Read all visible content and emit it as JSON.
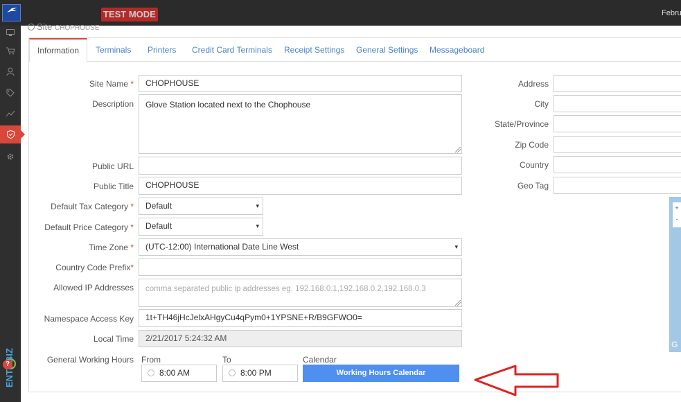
{
  "topbar": {
    "test_mode": "TEST MODE",
    "date": "Februa",
    "logo_text": "Mizuno"
  },
  "sidebar": {
    "brand": "ENTOBIZ",
    "help": "?",
    "icons": [
      "monitor-icon",
      "cart-icon",
      "users-icon",
      "tag-icon",
      "chart-icon",
      "shield-icon",
      "gear-icon"
    ]
  },
  "page": {
    "title": "Site",
    "subtitle": "CHOPHOUSE"
  },
  "tabs": [
    "Information",
    "Terminals",
    "Printers",
    "Credit Card Terminals",
    "Receipt Settings",
    "General Settings",
    "Messageboard"
  ],
  "form": {
    "site_name": {
      "label": "Site Name",
      "value": "CHOPHOUSE"
    },
    "description": {
      "label": "Description",
      "value": "Glove Station located next to the Chophouse"
    },
    "public_url": {
      "label": "Public URL",
      "value": ""
    },
    "public_title": {
      "label": "Public Title",
      "value": "CHOPHOUSE"
    },
    "tax_category": {
      "label": "Default Tax Category",
      "value": "Default"
    },
    "price_category": {
      "label": "Default Price Category",
      "value": "Default"
    },
    "time_zone": {
      "label": "Time Zone",
      "value": "(UTC-12:00) International Date Line West"
    },
    "country_code_prefix": {
      "label": "Country Code Prefix",
      "value": ""
    },
    "allowed_ips": {
      "label": "Allowed IP Addresses",
      "placeholder": "comma separated public ip addresses eg. 192.168.0.1,192.168.0.2,192.168.0.3"
    },
    "namespace_key": {
      "label": "Namespace Access Key",
      "value": "1t+TH46jHcJelxAHgyCu4qPym0+1YPSNE+R/B9GFWO0="
    },
    "local_time": {
      "label": "Local Time",
      "value": "2/21/2017 5:24:32 AM"
    },
    "working_hours": {
      "label": "General Working Hours",
      "from_label": "From",
      "from_value": "8:00 AM",
      "to_label": "To",
      "to_value": "8:00 PM",
      "calendar_label": "Calendar",
      "button": "Working Hours Calendar"
    },
    "required_mark": "*"
  },
  "address": {
    "address": {
      "label": "Address",
      "value": ""
    },
    "city": {
      "label": "City",
      "value": ""
    },
    "state": {
      "label": "State/Province",
      "value": ""
    },
    "zip": {
      "label": "Zip Code",
      "value": ""
    },
    "country": {
      "label": "Country",
      "value": ""
    },
    "geo_tag": {
      "label": "Geo Tag",
      "value": ""
    }
  },
  "map": {
    "zoom_in": "+",
    "zoom_out": "-",
    "attribution": "G"
  },
  "colors": {
    "accent": "#d9473b",
    "link": "#4a84c4",
    "button": "#4e8ff0",
    "arrow": "#e02020"
  }
}
